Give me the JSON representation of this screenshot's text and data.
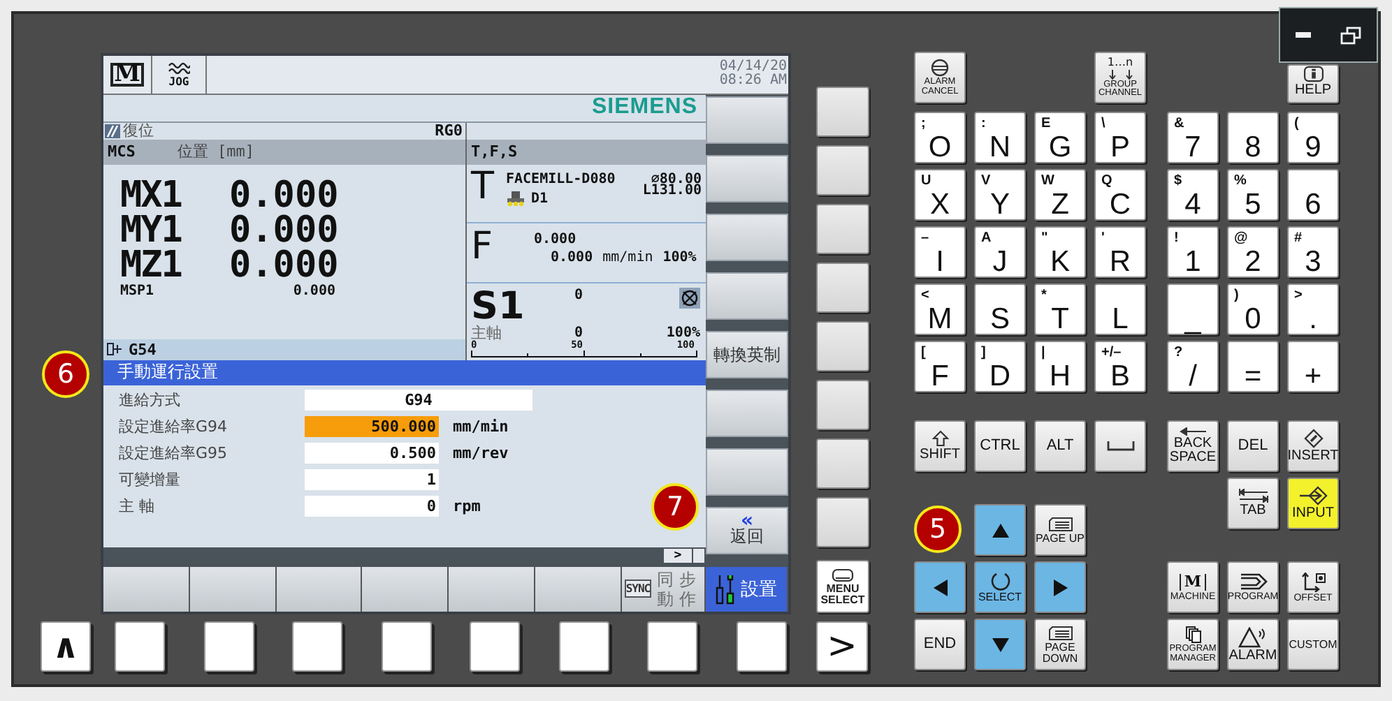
{
  "screen": {
    "mode": {
      "icon_text": "M",
      "label": "JOG"
    },
    "date": "04/14/20",
    "time": "08:26 AM",
    "brand": "SIEMENS",
    "status": {
      "text": "復位",
      "channel": "RG0"
    },
    "position": {
      "frame": "MCS",
      "heading": "位置 [mm]",
      "axes": [
        {
          "name": "MX1",
          "value": "0.000"
        },
        {
          "name": "MY1",
          "value": "0.000"
        },
        {
          "name": "MZ1",
          "value": "0.000"
        }
      ],
      "spindle": {
        "name": "MSP1",
        "value": "0.000"
      },
      "work_offset": "G54"
    },
    "tfs": {
      "heading": "T,F,S",
      "tool": {
        "letter": "T",
        "name": "FACEMILL-D080",
        "diameter": "⌀80.00",
        "length": "L131.00",
        "edge": "D1"
      },
      "feed": {
        "letter": "F",
        "actual": "0.000",
        "setpoint": "0.000",
        "unit": "mm/min",
        "override": "100%"
      },
      "spindle": {
        "letter": "S1",
        "actual": "0",
        "label": "主軸",
        "setpoint": "0",
        "override": "100%",
        "scale": [
          "0",
          "50",
          "100"
        ]
      }
    },
    "dialog": {
      "title": "手動運行設置",
      "fields": [
        {
          "kind": "toggle",
          "label": "進給方式",
          "value": "G94",
          "highlighted": false
        },
        {
          "kind": "number",
          "label": "設定進給率G94",
          "value": "500.000",
          "unit": "mm/min",
          "highlighted": true
        },
        {
          "kind": "number",
          "label": "設定進給率G95",
          "value": "0.500",
          "unit": "mm/rev",
          "highlighted": false
        },
        {
          "kind": "number",
          "label": "可變增量",
          "value": "1",
          "highlighted": false
        },
        {
          "kind": "number",
          "label": "主 軸",
          "value": "0",
          "unit": "rpm",
          "highlighted": false
        }
      ]
    },
    "vertical_softkeys": [
      {
        "kind": "blank"
      },
      {
        "kind": "blank"
      },
      {
        "kind": "blank"
      },
      {
        "kind": "blank"
      },
      {
        "kind": "text",
        "label": "轉換英制"
      },
      {
        "kind": "blank"
      },
      {
        "kind": "blank"
      },
      {
        "kind": "back",
        "icon_text": "«",
        "label": "返回"
      }
    ],
    "more": ">",
    "horizontal_softkeys": [
      {
        "kind": "blank",
        "selected": false
      },
      {
        "kind": "blank",
        "selected": false
      },
      {
        "kind": "blank",
        "selected": false
      },
      {
        "kind": "blank",
        "selected": false
      },
      {
        "kind": "blank",
        "selected": false
      },
      {
        "kind": "blank",
        "selected": false
      },
      {
        "kind": "sync",
        "icon_text": "SYNC",
        "label": "同步動作",
        "selected": false
      },
      {
        "kind": "setup",
        "label": "設置",
        "selected": true
      }
    ]
  },
  "side": {
    "menu_select": "MENU SELECT",
    "next": ">",
    "previous": "∧"
  },
  "keypad": {
    "top_keys": [
      {
        "kind": "alarm-cancel",
        "label": "ALARM CANCEL"
      },
      {
        "kind": "group-channel",
        "icon_text": "1…n",
        "label": "GROUP CHANNEL"
      },
      {
        "kind": "help",
        "label": "HELP"
      }
    ],
    "char_rows": [
      [
        {
          "main": "O",
          "alt": ";"
        },
        {
          "main": "N",
          "alt": ":"
        },
        {
          "main": "G",
          "alt": "E"
        },
        {
          "main": "P",
          "alt": "\\"
        },
        {
          "main": "7",
          "alt": "&"
        },
        {
          "main": "8"
        },
        {
          "main": "9",
          "alt": "("
        }
      ],
      [
        {
          "main": "X",
          "alt": "U"
        },
        {
          "main": "Y",
          "alt": "V"
        },
        {
          "main": "Z",
          "alt": "W"
        },
        {
          "main": "C",
          "alt": "Q"
        },
        {
          "main": "4",
          "alt": "$"
        },
        {
          "main": "5",
          "alt": "%"
        },
        {
          "main": "6"
        }
      ],
      [
        {
          "main": "I",
          "alt": "–"
        },
        {
          "main": "J",
          "alt": "A"
        },
        {
          "main": "K",
          "alt": "\""
        },
        {
          "main": "R",
          "alt": "'"
        },
        {
          "main": "1",
          "alt": "!"
        },
        {
          "main": "2",
          "alt": "@"
        },
        {
          "main": "3",
          "alt": "#"
        }
      ],
      [
        {
          "main": "M",
          "alt": "<"
        },
        {
          "main": "S"
        },
        {
          "main": "T",
          "alt": "*"
        },
        {
          "main": "L"
        },
        {
          "main": "_"
        },
        {
          "main": "0",
          "alt": ")"
        },
        {
          "main": ".",
          "alt": ">"
        }
      ],
      [
        {
          "main": "F",
          "alt": "["
        },
        {
          "main": "D",
          "alt": "]"
        },
        {
          "main": "H",
          "alt": "|"
        },
        {
          "main": "B",
          "alt": "+/–"
        },
        {
          "main": "/",
          "alt": "?"
        },
        {
          "main": "="
        },
        {
          "main": "+"
        }
      ]
    ],
    "lower_keys": [
      {
        "kind": "shift",
        "label": "SHIFT"
      },
      {
        "kind": "ctrl",
        "label": "CTRL"
      },
      {
        "kind": "alt",
        "label": "ALT"
      },
      {
        "kind": "space"
      },
      {
        "kind": "backspace",
        "label": "BACK SPACE"
      },
      {
        "kind": "del",
        "label": "DEL"
      },
      {
        "kind": "insert",
        "label": "INSERT"
      },
      {
        "kind": "tab",
        "label": "TAB"
      },
      {
        "kind": "input",
        "label": "INPUT"
      },
      {
        "kind": "up"
      },
      {
        "kind": "page-up",
        "label": "PAGE UP"
      },
      {
        "kind": "left"
      },
      {
        "kind": "select",
        "label": "SELECT"
      },
      {
        "kind": "right"
      },
      {
        "kind": "end",
        "label": "END"
      },
      {
        "kind": "down"
      },
      {
        "kind": "page-down",
        "label": "PAGE DOWN"
      },
      {
        "kind": "machine",
        "icon_text": "M",
        "label": "MACHINE"
      },
      {
        "kind": "program",
        "label": "PROGRAM"
      },
      {
        "kind": "offset",
        "label": "OFFSET"
      },
      {
        "kind": "program-manager",
        "label": "PROGRAM MANAGER"
      },
      {
        "kind": "alarm",
        "label": "ALARM"
      },
      {
        "kind": "custom",
        "label": "CUSTOM"
      }
    ]
  },
  "markers": [
    {
      "number": "6"
    },
    {
      "number": "7"
    },
    {
      "number": "5"
    }
  ]
}
